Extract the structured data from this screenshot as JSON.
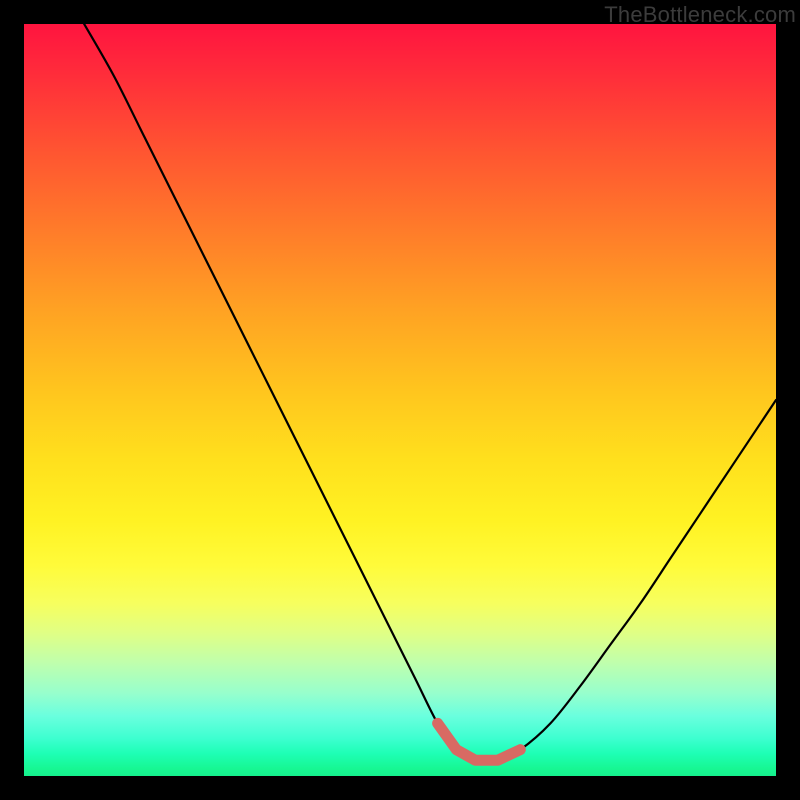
{
  "watermark": "TheBottleneck.com",
  "chart_data": {
    "type": "line",
    "title": "",
    "xlabel": "",
    "ylabel": "",
    "xlim": [
      0,
      100
    ],
    "ylim": [
      0,
      100
    ],
    "grid": false,
    "legend": false,
    "series": [
      {
        "name": "bottleneck-curve",
        "color": "#000000",
        "x": [
          8,
          12,
          16,
          20,
          24,
          28,
          32,
          36,
          40,
          44,
          48,
          52,
          55,
          57.5,
          60,
          63,
          66,
          70,
          74,
          78,
          82,
          86,
          90,
          94,
          98,
          100
        ],
        "y": [
          100,
          93,
          85,
          77,
          69,
          61,
          53,
          45,
          37,
          29,
          21,
          13,
          7,
          3.5,
          2,
          2,
          3.5,
          7,
          12,
          17.5,
          23,
          29,
          35,
          41,
          47,
          50
        ]
      }
    ],
    "highlight_segment": {
      "name": "optimal-range",
      "color": "#d86a63",
      "x": [
        55,
        57.5,
        60,
        63,
        66
      ],
      "y": [
        7,
        3.5,
        2.1,
        2.1,
        3.5
      ]
    },
    "background_gradient": {
      "stops": [
        {
          "pos": 0.0,
          "color": "#ff143f"
        },
        {
          "pos": 0.25,
          "color": "#ff7a2a"
        },
        {
          "pos": 0.5,
          "color": "#ffe01d"
        },
        {
          "pos": 0.75,
          "color": "#f7ff5e"
        },
        {
          "pos": 0.9,
          "color": "#6affde"
        },
        {
          "pos": 1.0,
          "color": "#15ef8d"
        }
      ]
    }
  }
}
